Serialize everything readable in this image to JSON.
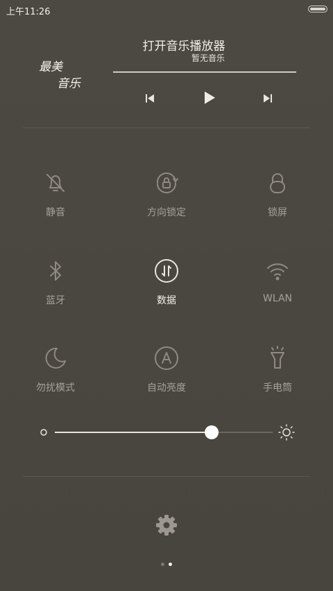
{
  "status_bar": {
    "time": "上午11:26",
    "icons": [
      "battery-icon"
    ]
  },
  "music_widget": {
    "logo_line1": "最美",
    "logo_line2": "音乐",
    "title": "打开音乐播放器",
    "subtitle": "暂无音乐",
    "controls": [
      "previous-icon",
      "play-icon",
      "next-icon"
    ]
  },
  "toggles": [
    {
      "label": "静音",
      "icon": "bell-slash-icon",
      "on": false
    },
    {
      "label": "方向锁定",
      "icon": "rotation-lock-icon",
      "on": false
    },
    {
      "label": "锁屏",
      "icon": "lock-icon",
      "on": false
    },
    {
      "label": "蓝牙",
      "icon": "bluetooth-icon",
      "on": false
    },
    {
      "label": "数据",
      "icon": "data-icon",
      "on": true
    },
    {
      "label": "WLAN",
      "icon": "wifi-icon",
      "on": false
    },
    {
      "label": "勿扰模式",
      "icon": "moon-icon",
      "on": false
    },
    {
      "label": "自动亮度",
      "icon": "auto-brightness-icon",
      "on": false
    },
    {
      "label": "手电筒",
      "icon": "flashlight-icon",
      "on": false
    }
  ],
  "brightness": {
    "value_fraction": 0.72,
    "icons": [
      "brightness-low-icon",
      "brightness-high-icon"
    ]
  },
  "settings": {
    "icon": "gear-icon"
  },
  "pager": {
    "pages": 2,
    "current": 2
  },
  "colors": {
    "background": "#4a4740",
    "text": "#f2f0eb",
    "muted": "#a5a29b",
    "icon": "#8f8b84"
  }
}
